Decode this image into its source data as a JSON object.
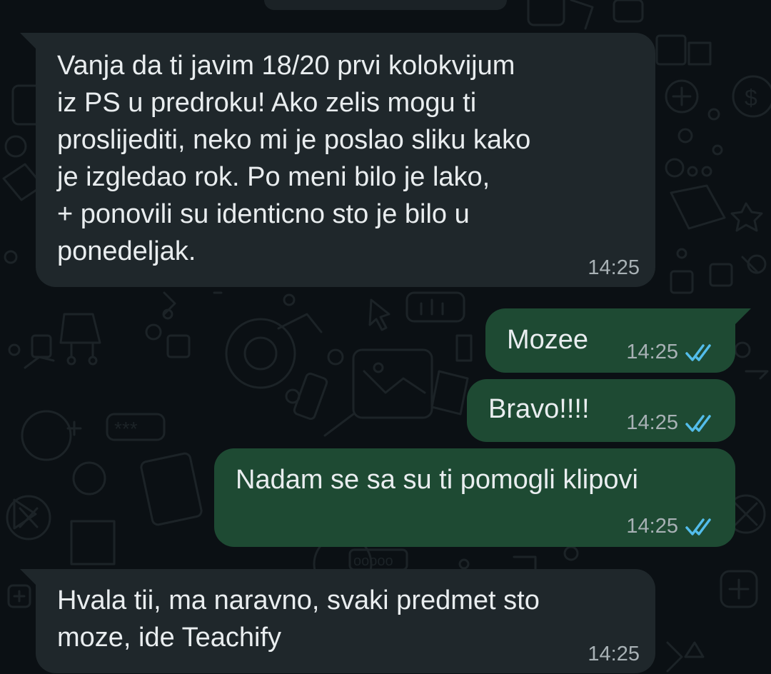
{
  "messages": [
    {
      "direction": "incoming",
      "text": "Vanja da ti javim 18/20 prvi kolokvijum\niz PS u predroku! Ako zelis mogu ti\nproslijediti, neko mi je poslao sliku kako\nje izgledao rok. Po meni bilo je lako,\n+ ponovili su identicno sto je bilo u\nponedeljak.",
      "time": "14:25"
    },
    {
      "direction": "outgoing",
      "text": "Mozee",
      "time": "14:25",
      "status_icon": "double-check-read-icon"
    },
    {
      "direction": "outgoing",
      "text": "Bravo!!!!",
      "time": "14:25",
      "status_icon": "double-check-read-icon"
    },
    {
      "direction": "outgoing",
      "text": "Nadam se sa su ti pomogli klipovi",
      "time": "14:25",
      "status_icon": "double-check-read-icon"
    },
    {
      "direction": "incoming",
      "text": "Hvala tii, ma naravno, svaki predmet sto\nmoze, ide Teachify",
      "time": "14:25"
    }
  ],
  "colors": {
    "background": "#0b1014",
    "incoming_bubble": "#1f272b",
    "outgoing_bubble": "#1e4a33",
    "text": "#e9edef",
    "timestamp": "#a8b1b5",
    "read_ticks": "#53bdeb"
  }
}
